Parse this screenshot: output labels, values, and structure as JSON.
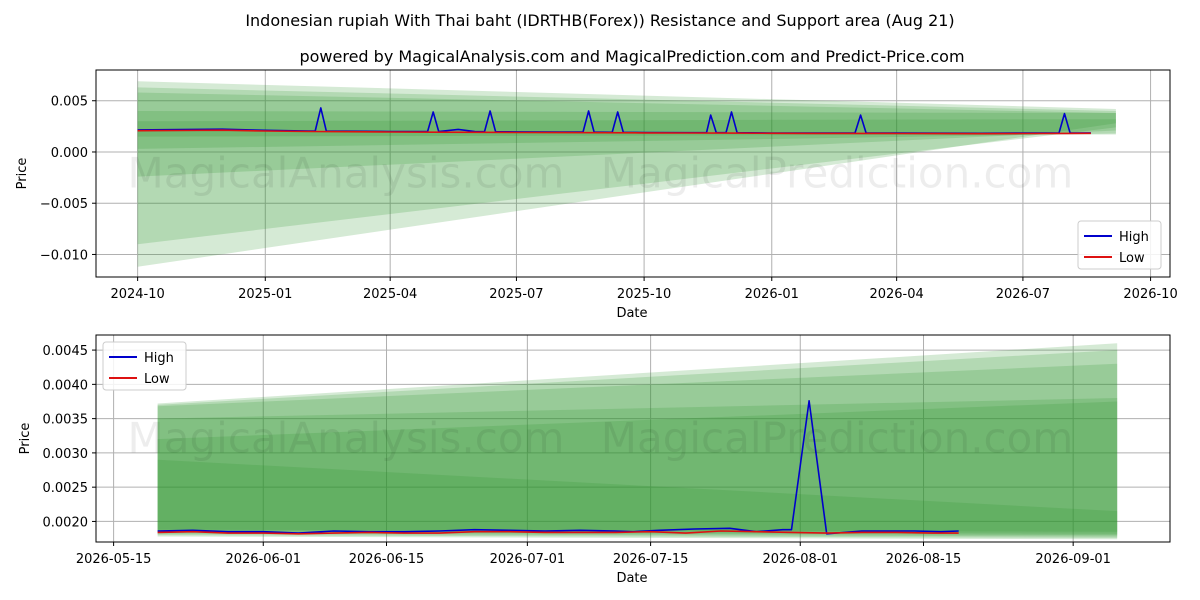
{
  "figure": {
    "title": "Indonesian rupiah With Thai baht (IDRTHB(Forex)) Resistance and Support area (Aug 21)",
    "subtitle": "powered by MagicalAnalysis.com and MagicalPrediction.com and Predict-Price.com",
    "watermark_left": "MagicalAnalysis.com",
    "watermark_right": "MagicalPrediction.com"
  },
  "colors": {
    "high": "#0000cc",
    "low": "#dd1111",
    "band": "#2e962e",
    "grid": "#b0b0b0"
  },
  "chart_data": [
    {
      "type": "line",
      "xlabel": "Date",
      "ylabel": "Price",
      "xlim": [
        "2024-09-01",
        "2026-10-15"
      ],
      "ylim": [
        -0.0122,
        0.008
      ],
      "grid": true,
      "legend": "lower right",
      "x_ticks": [
        "2024-10",
        "2025-01",
        "2025-04",
        "2025-07",
        "2025-10",
        "2026-01",
        "2026-04",
        "2026-07",
        "2026-10"
      ],
      "y_ticks": [
        "0.005",
        "0.000",
        "−0.005",
        "−0.010"
      ],
      "series": [
        {
          "name": "High",
          "x": [
            "2024-10-01",
            "2024-11-01",
            "2024-12-01",
            "2025-01-01",
            "2025-02-01",
            "2025-02-06",
            "2025-02-10",
            "2025-02-14",
            "2025-03-01",
            "2025-04-01",
            "2025-04-28",
            "2025-05-02",
            "2025-05-06",
            "2025-05-20",
            "2025-06-01",
            "2025-06-08",
            "2025-06-12",
            "2025-06-16",
            "2025-07-01",
            "2025-08-01",
            "2025-08-18",
            "2025-08-22",
            "2025-08-26",
            "2025-09-08",
            "2025-09-12",
            "2025-09-16",
            "2025-10-01",
            "2025-11-01",
            "2025-11-15",
            "2025-11-18",
            "2025-11-22",
            "2025-11-29",
            "2025-12-03",
            "2025-12-07",
            "2026-01-01",
            "2026-02-01",
            "2026-03-02",
            "2026-03-06",
            "2026-03-10",
            "2026-04-01",
            "2026-05-01",
            "2026-06-01",
            "2026-07-01",
            "2026-07-27",
            "2026-07-31",
            "2026-08-04",
            "2026-08-19"
          ],
          "values": [
            0.00215,
            0.00218,
            0.00222,
            0.00212,
            0.00205,
            0.00205,
            0.0043,
            0.00205,
            0.00203,
            0.002,
            0.002,
            0.0039,
            0.002,
            0.0022,
            0.002,
            0.00198,
            0.004,
            0.00198,
            0.00196,
            0.00194,
            0.00194,
            0.004,
            0.00194,
            0.00192,
            0.0039,
            0.00192,
            0.0019,
            0.00188,
            0.00188,
            0.0036,
            0.00188,
            0.00188,
            0.0039,
            0.00188,
            0.00185,
            0.00185,
            0.00185,
            0.0036,
            0.00185,
            0.00185,
            0.00183,
            0.00182,
            0.00185,
            0.00185,
            0.00375,
            0.00185,
            0.00186
          ]
        },
        {
          "name": "Low",
          "x": [
            "2024-10-01",
            "2024-11-01",
            "2024-12-01",
            "2025-01-01",
            "2025-02-01",
            "2025-03-01",
            "2025-04-01",
            "2025-05-01",
            "2025-06-01",
            "2025-07-01",
            "2025-08-01",
            "2025-09-01",
            "2025-10-01",
            "2025-11-01",
            "2025-12-01",
            "2026-01-01",
            "2026-02-01",
            "2026-03-01",
            "2026-04-01",
            "2026-05-01",
            "2026-06-01",
            "2026-07-01",
            "2026-08-01",
            "2026-08-19"
          ],
          "values": [
            0.00208,
            0.0021,
            0.00213,
            0.00205,
            0.002,
            0.00198,
            0.00195,
            0.00193,
            0.00192,
            0.0019,
            0.00189,
            0.00188,
            0.00186,
            0.00185,
            0.00184,
            0.00182,
            0.00181,
            0.00181,
            0.0018,
            0.00179,
            0.00178,
            0.0018,
            0.00181,
            0.00182
          ]
        }
      ],
      "bands": [
        {
          "start": "2024-10-01",
          "end": "2026-09-06",
          "top": [
            0.0069,
            0.0042
          ],
          "bottom": [
            -0.0112,
            0.0028
          ]
        },
        {
          "start": "2024-10-01",
          "end": "2026-09-06",
          "top": [
            0.0063,
            0.004
          ],
          "bottom": [
            -0.009,
            0.0024
          ]
        },
        {
          "start": "2024-10-01",
          "end": "2026-09-06",
          "top": [
            0.0058,
            0.0038
          ],
          "bottom": [
            -0.0024,
            0.0021
          ]
        },
        {
          "start": "2024-10-01",
          "end": "2026-09-06",
          "top": [
            0.004,
            0.0038
          ],
          "bottom": [
            0.0003,
            0.0018
          ]
        },
        {
          "start": "2024-10-01",
          "end": "2026-09-06",
          "top": [
            0.003,
            0.0032
          ],
          "bottom": [
            0.0015,
            0.0017
          ]
        }
      ]
    },
    {
      "type": "line",
      "xlabel": "Date",
      "ylabel": "Price",
      "xlim": [
        "2026-05-13",
        "2026-09-12"
      ],
      "ylim": [
        0.0017,
        0.00472
      ],
      "grid": true,
      "legend": "upper left",
      "x_ticks": [
        "2026-05-15",
        "2026-06-01",
        "2026-06-15",
        "2026-07-01",
        "2026-07-15",
        "2026-08-01",
        "2026-08-15",
        "2026-09-01"
      ],
      "y_ticks": [
        "0.0045",
        "0.0040",
        "0.0035",
        "0.0030",
        "0.0025",
        "0.0020"
      ],
      "series": [
        {
          "name": "High",
          "x": [
            "2026-05-20",
            "2026-05-24",
            "2026-05-28",
            "2026-06-01",
            "2026-06-05",
            "2026-06-09",
            "2026-06-13",
            "2026-06-17",
            "2026-06-21",
            "2026-06-25",
            "2026-06-29",
            "2026-07-03",
            "2026-07-07",
            "2026-07-11",
            "2026-07-13",
            "2026-07-16",
            "2026-07-20",
            "2026-07-24",
            "2026-07-27",
            "2026-07-30",
            "2026-07-31",
            "2026-08-02",
            "2026-08-04",
            "2026-08-08",
            "2026-08-10",
            "2026-08-14",
            "2026-08-17",
            "2026-08-19"
          ],
          "values": [
            0.00186,
            0.00187,
            0.00185,
            0.00185,
            0.00183,
            0.00186,
            0.00185,
            0.00185,
            0.00186,
            0.00188,
            0.00187,
            0.00186,
            0.00187,
            0.00186,
            0.00185,
            0.00187,
            0.00189,
            0.0019,
            0.00185,
            0.00188,
            0.00188,
            0.00376,
            0.00182,
            0.00186,
            0.00186,
            0.00186,
            0.00185,
            0.00186
          ]
        },
        {
          "name": "Low",
          "x": [
            "2026-05-20",
            "2026-05-24",
            "2026-05-28",
            "2026-06-01",
            "2026-06-05",
            "2026-06-09",
            "2026-06-13",
            "2026-06-17",
            "2026-06-21",
            "2026-06-25",
            "2026-06-29",
            "2026-07-03",
            "2026-07-07",
            "2026-07-11",
            "2026-07-15",
            "2026-07-19",
            "2026-07-23",
            "2026-07-27",
            "2026-07-31",
            "2026-08-04",
            "2026-08-08",
            "2026-08-12",
            "2026-08-16",
            "2026-08-19"
          ],
          "values": [
            0.00184,
            0.00185,
            0.00183,
            0.00183,
            0.00182,
            0.00183,
            0.00184,
            0.00183,
            0.00183,
            0.00185,
            0.00185,
            0.00184,
            0.00184,
            0.00184,
            0.00185,
            0.00183,
            0.00186,
            0.00185,
            0.00184,
            0.00183,
            0.00184,
            0.00184,
            0.00183,
            0.00183
          ]
        }
      ],
      "bands": [
        {
          "start": "2026-05-20",
          "end": "2026-09-06",
          "top": [
            0.00372,
            0.0046
          ],
          "bottom": [
            0.00178,
            0.00174
          ]
        },
        {
          "start": "2026-05-20",
          "end": "2026-09-06",
          "top": [
            0.0037,
            0.0045
          ],
          "bottom": [
            0.0018,
            0.00176
          ]
        },
        {
          "start": "2026-05-20",
          "end": "2026-09-06",
          "top": [
            0.00368,
            0.0043
          ],
          "bottom": [
            0.00182,
            0.00178
          ]
        },
        {
          "start": "2026-05-20",
          "end": "2026-09-06",
          "top": [
            0.0035,
            0.0038
          ],
          "bottom": [
            0.00184,
            0.0018
          ]
        },
        {
          "start": "2026-05-20",
          "end": "2026-09-06",
          "top": [
            0.0032,
            0.00375
          ],
          "bottom": [
            0.00186,
            0.00182
          ]
        },
        {
          "start": "2026-05-20",
          "end": "2026-09-06",
          "top": [
            0.0029,
            0.00215
          ],
          "bottom": [
            0.00188,
            0.00185
          ]
        }
      ]
    }
  ]
}
